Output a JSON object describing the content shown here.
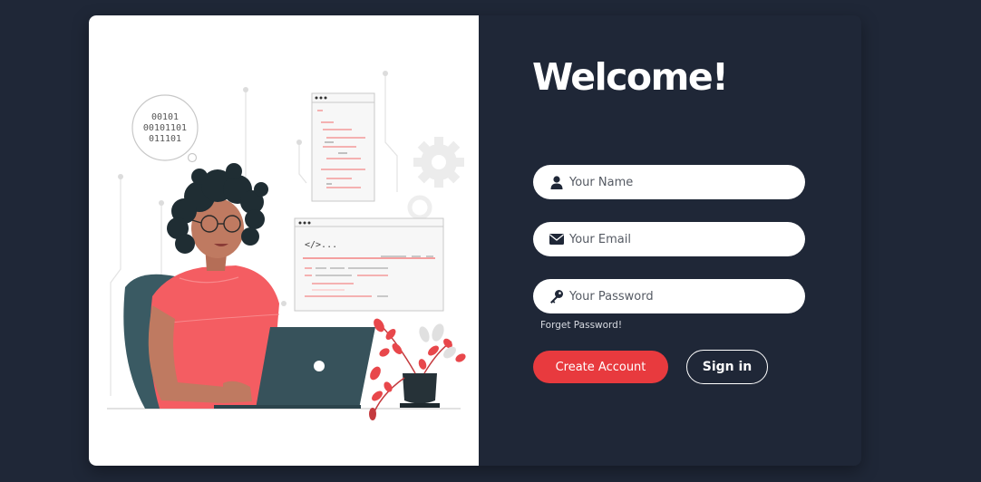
{
  "form": {
    "title": "Welcome!",
    "name_placeholder": "Your Name",
    "email_placeholder": "Your Email",
    "password_placeholder": "Your Password",
    "forget_password": "Forget Password!",
    "create_account": "Create Account",
    "sign_in": "Sign in"
  },
  "illustration": {
    "binary_line1": "00101",
    "binary_line2": "00101101",
    "binary_line3": "011101",
    "code_tag": "</>..."
  },
  "colors": {
    "background": "#1f2737",
    "accent": "#e83a3e",
    "field": "#ffffff"
  },
  "icons": {
    "name_field": "user-icon",
    "email_field": "envelope-icon",
    "password_field": "key-icon"
  }
}
